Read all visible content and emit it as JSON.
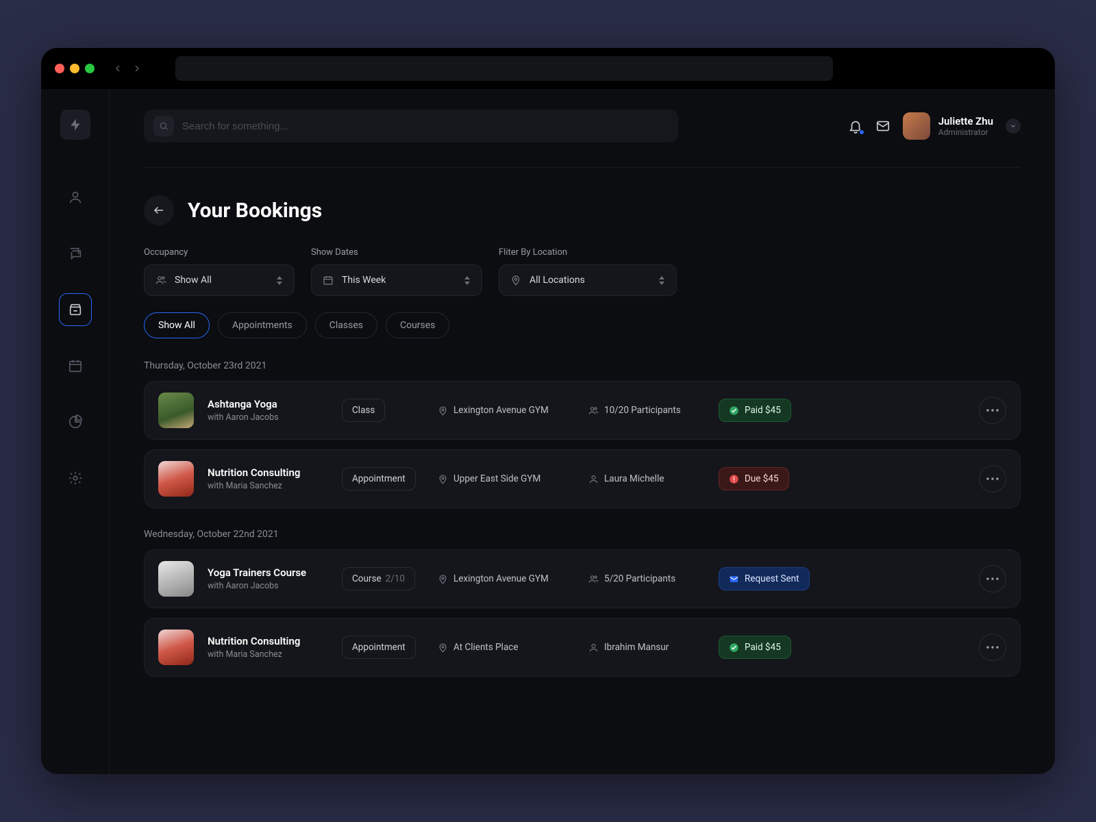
{
  "search": {
    "placeholder": "Search for something..."
  },
  "user": {
    "name": "Juliette Zhu",
    "role": "Administrator"
  },
  "page": {
    "title": "Your Bookings"
  },
  "filters": {
    "occupancy": {
      "label": "Occupancy",
      "value": "Show All"
    },
    "dates": {
      "label": "Show Dates",
      "value": "This Week"
    },
    "location": {
      "label": "Fliter By Location",
      "value": "All Locations"
    }
  },
  "tabs": {
    "all": "Show All",
    "appointments": "Appointments",
    "classes": "Classes",
    "courses": "Courses"
  },
  "groups": [
    {
      "date": "Thursday, October 23rd 2021",
      "items": [
        {
          "title": "Ashtanga Yoga",
          "subtitle": "with Aaron Jacobs",
          "type": "Class",
          "type_extra": "",
          "location": "Lexington Avenue GYM",
          "participants": "10/20 Participants",
          "person": "",
          "status_kind": "paid",
          "status_text": "Paid $45",
          "thumb": "yoga"
        },
        {
          "title": "Nutrition Consulting",
          "subtitle": "with Maria Sanchez",
          "type": "Appointment",
          "type_extra": "",
          "location": "Upper East Side GYM",
          "participants": "",
          "person": "Laura Michelle",
          "status_kind": "due",
          "status_text": "Due $45",
          "thumb": "nutri"
        }
      ]
    },
    {
      "date": "Wednesday, October 22nd 2021",
      "items": [
        {
          "title": "Yoga Trainers Course",
          "subtitle": "with Aaron Jacobs",
          "type": "Course",
          "type_extra": "2/10",
          "location": "Lexington Avenue GYM",
          "participants": "5/20 Participants",
          "person": "",
          "status_kind": "sent",
          "status_text": "Request Sent",
          "thumb": "trainer"
        },
        {
          "title": "Nutrition Consulting",
          "subtitle": "with Maria Sanchez",
          "type": "Appointment",
          "type_extra": "",
          "location": "At Clients Place",
          "participants": "",
          "person": "Ibrahim Mansur",
          "status_kind": "paid",
          "status_text": "Paid $45",
          "thumb": "nutri"
        }
      ]
    }
  ]
}
